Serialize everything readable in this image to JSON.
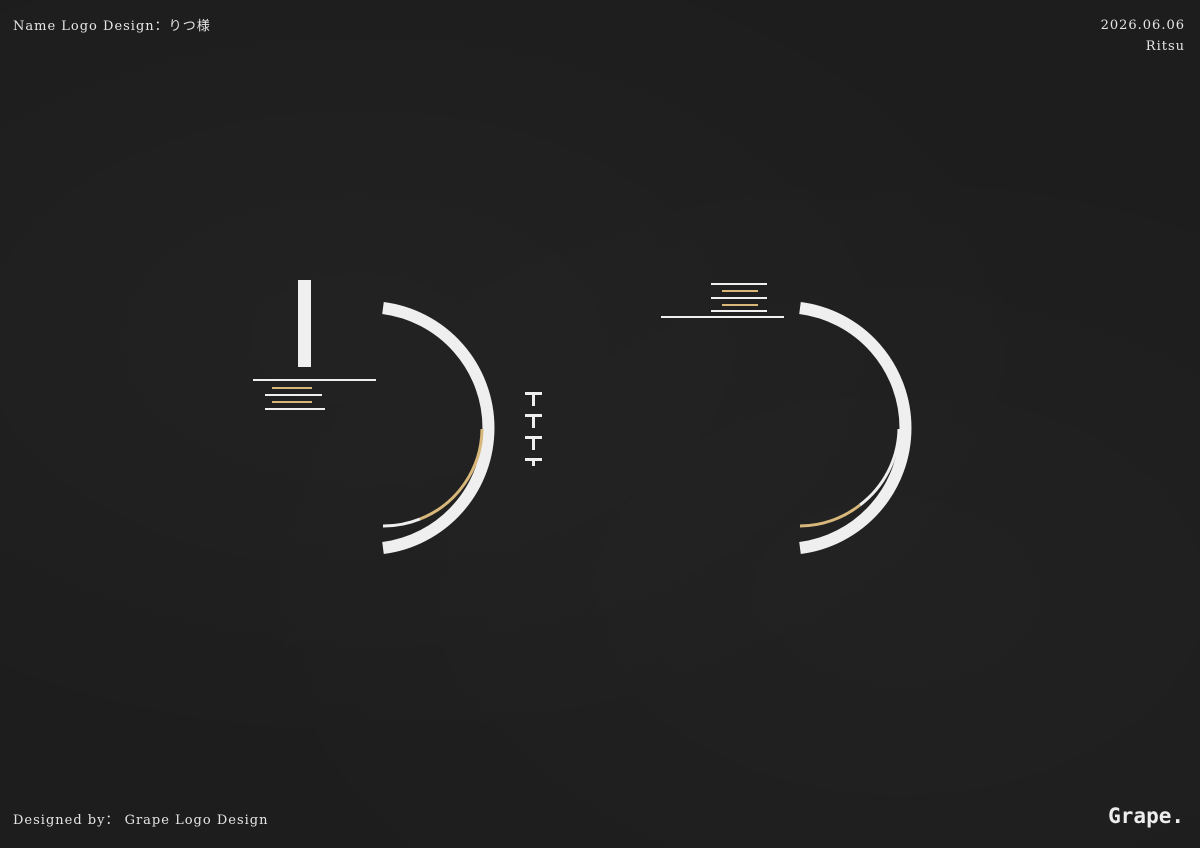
{
  "header": {
    "title": "Name Logo Design：りつ様",
    "date": "2026.06.06",
    "name": "Ritsu"
  },
  "footer": {
    "designer_label": "Designed by： Grape Logo Design",
    "brand": "Grape."
  },
  "colors": {
    "background": "#1d1d1d",
    "stroke": "#efefef",
    "accent": "#d8b77a"
  },
  "logo": {
    "glyph_1": "り",
    "glyph_2": "つ"
  }
}
